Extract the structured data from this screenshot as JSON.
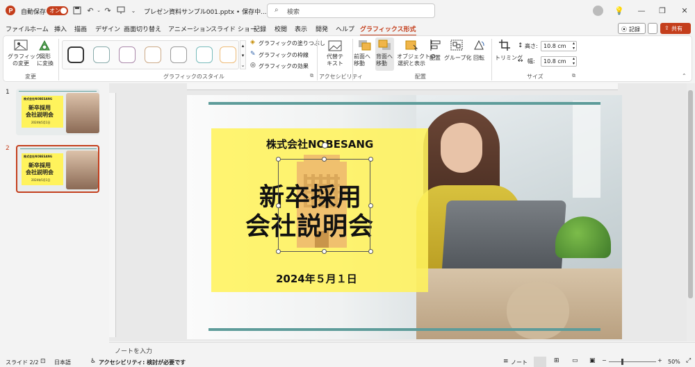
{
  "titlebar": {
    "autosave_label": "自動保存",
    "autosave_state": "オン",
    "doc_title": "プレゼン資料サンプル001.pptx • 保存中...",
    "search_placeholder": "検索"
  },
  "tabs": [
    "ファイル",
    "ホーム",
    "挿入",
    "描画",
    "デザイン",
    "画面切り替え",
    "アニメーション",
    "スライド ショー",
    "記録",
    "校閲",
    "表示",
    "開発",
    "ヘルプ",
    "グラフィックス形式"
  ],
  "right_buttons": {
    "record": "記録",
    "share": "共有"
  },
  "ribbon": {
    "change_graphic": "グラフィック\nの変更",
    "convert_shape": "図形\nに変換",
    "group_change": "変更",
    "fill": "グラフィックの塗りつぶし",
    "outline": "グラフィックの枠線",
    "effects": "グラフィックの効果",
    "group_style": "グラフィックのスタイル",
    "alt_text": "代替テ\nキスト",
    "group_accessibility": "アクセシビリティ",
    "bring_forward": "前面へ\n移動",
    "send_backward": "背面へ\n移動",
    "selection_pane": "オブジェクトの\n選択と表示",
    "align": "配置",
    "group": "グループ化",
    "rotate": "回転",
    "group_arrange": "配置",
    "crop": "トリミング",
    "height_label": "高さ:",
    "height_value": "10.8 cm",
    "width_label": "幅:",
    "width_value": "10.8 cm",
    "group_size": "サイズ"
  },
  "thumbnails": [
    {
      "number": "1",
      "company": "株式会社NOBESANG",
      "title_line1": "新卒採用",
      "title_line2": "会社説明会",
      "date": "2024年5月1日"
    },
    {
      "number": "2",
      "company": "株式会社NOBESANG",
      "title_line1": "新卒採用",
      "title_line2": "会社説明会",
      "date": "2024年5月1日"
    }
  ],
  "slide": {
    "company": "株式会社NOBESANG",
    "title_line1": "新卒採用",
    "title_line2": "会社説明会",
    "date": "2024年５月１日",
    "accent_color": "#5e9c9a",
    "box_color": "#fff35c",
    "icon_color": "#f0c06e"
  },
  "notes_placeholder": "ノートを入力",
  "status": {
    "slide": "スライド 2/2",
    "language": "日本語",
    "accessibility": "アクセシビリティ: 検討が必要です",
    "notes": "ノート",
    "zoom": "50%"
  }
}
